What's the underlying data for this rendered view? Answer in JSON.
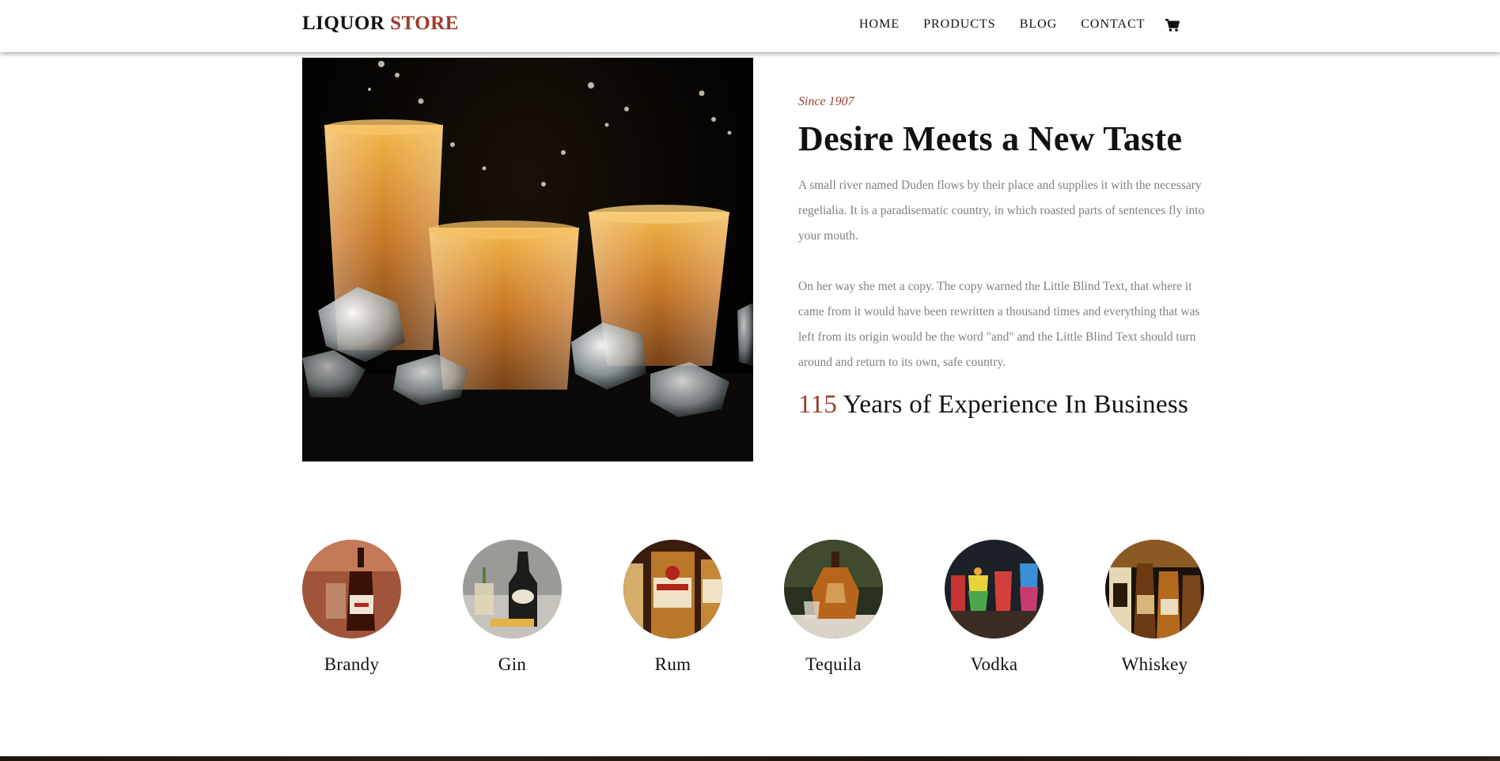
{
  "brand": {
    "primary": "LIQUOR",
    "accent": "STORE",
    "accent_color": "#9e3a2c"
  },
  "nav": {
    "items": [
      {
        "label": "HOME"
      },
      {
        "label": "PRODUCTS"
      },
      {
        "label": "BLOG"
      },
      {
        "label": "CONTACT"
      }
    ],
    "cart_icon": "shopping-cart-icon"
  },
  "hero": {
    "image": "whiskey-glasses-with-ice",
    "since": "Since 1907",
    "title": "Desire Meets a New Taste",
    "paragraph1": "A small river named Duden flows by their place and supplies it with the necessary regelialia. It is a paradisematic country, in which roasted parts of sentences fly into your mouth.",
    "paragraph2": "On her way she met a copy. The copy warned the Little Blind Text, that where it came from it would have been rewritten a thousand times and everything that was left from its origin would be the word \"and\" and the Little Blind Text should turn around and return to its own, safe country.",
    "experience_number": "115",
    "experience_text": " Years of Experience In Business"
  },
  "categories": [
    {
      "label": "Brandy",
      "image": "brandy-bottle"
    },
    {
      "label": "Gin",
      "image": "gin-bottle"
    },
    {
      "label": "Rum",
      "image": "rum-bottles"
    },
    {
      "label": "Tequila",
      "image": "tequila-bottle"
    },
    {
      "label": "Vodka",
      "image": "vodka-cocktails"
    },
    {
      "label": "Whiskey",
      "image": "whiskey-bottles"
    }
  ]
}
